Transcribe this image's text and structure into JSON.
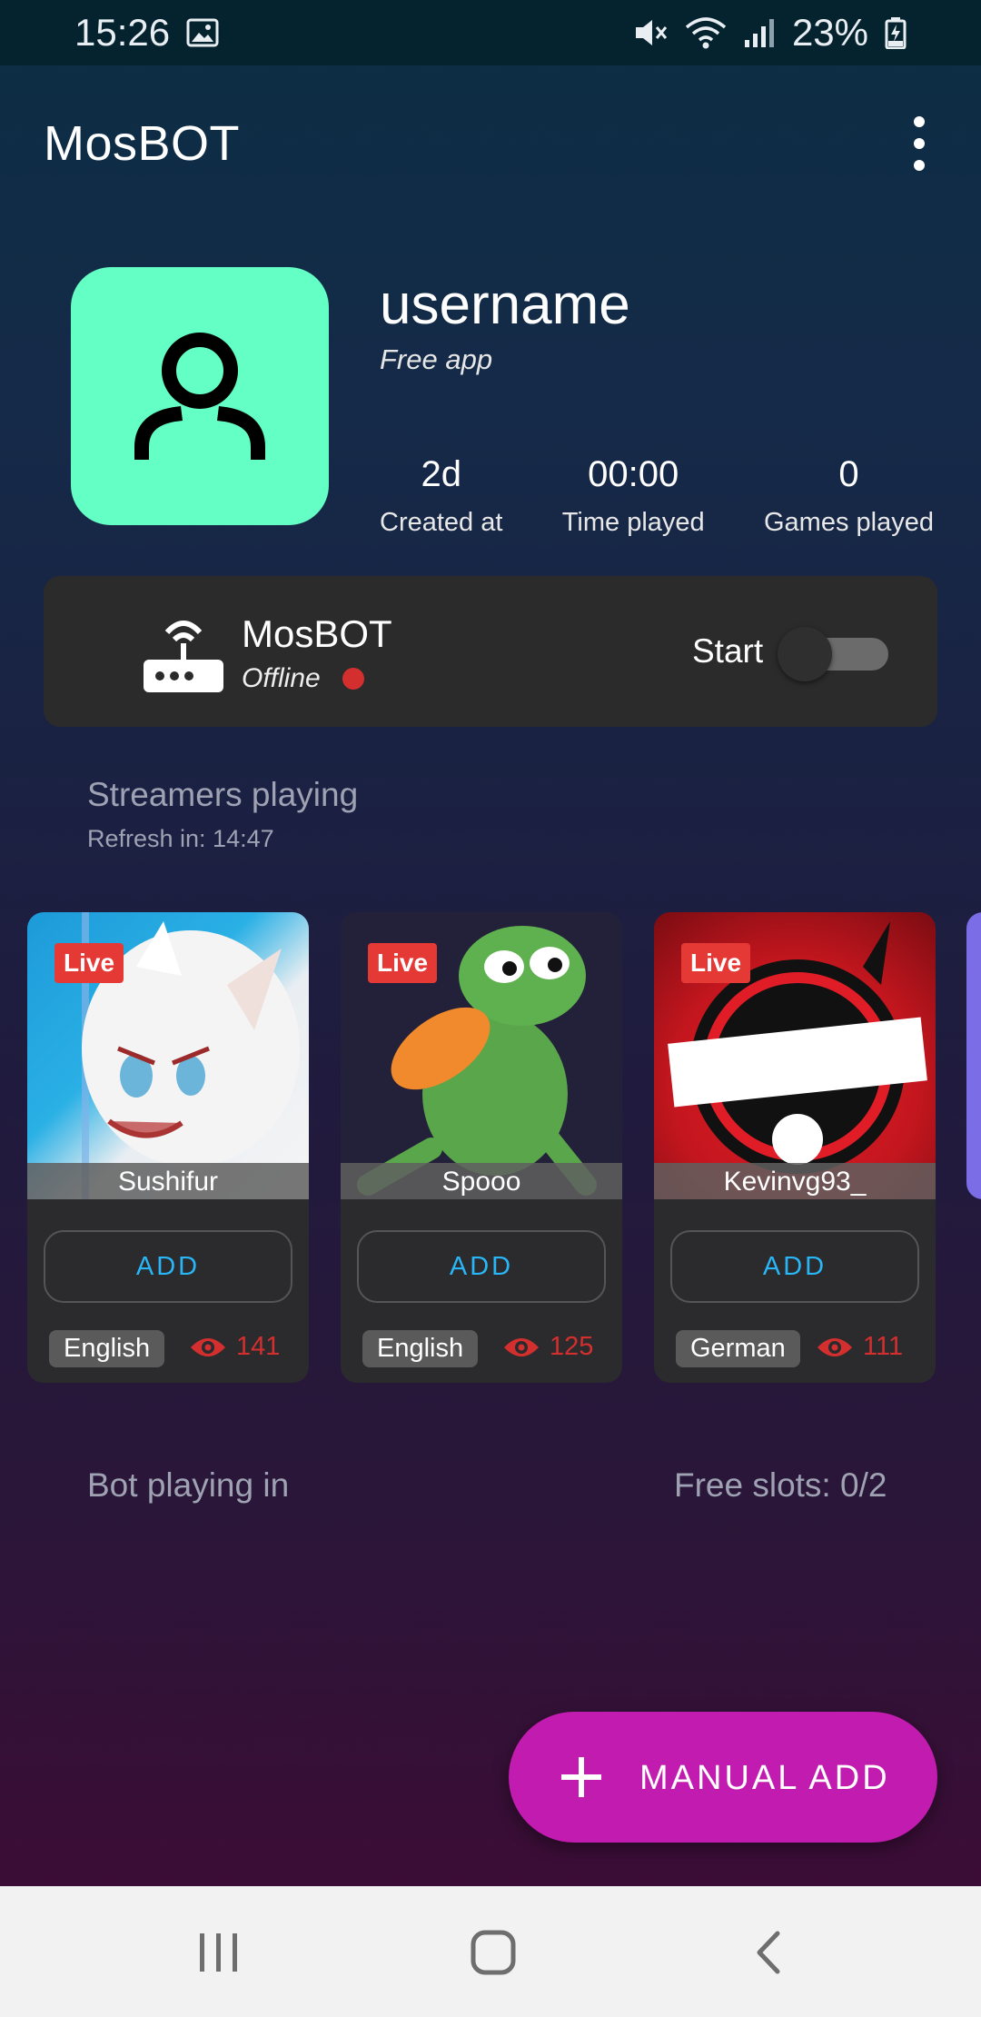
{
  "status_bar": {
    "time": "15:26",
    "battery": "23%",
    "icons": [
      "image-icon",
      "mute-icon",
      "wifi-icon",
      "signal-icon",
      "battery-charging-icon"
    ]
  },
  "app_bar": {
    "title": "MosBOT",
    "menu_icon": "more-vert-icon"
  },
  "profile": {
    "username": "username",
    "plan": "Free app",
    "avatar_icon": "person-icon",
    "avatar_color": "#64ffc4",
    "stats": [
      {
        "value": "2d",
        "label": "Created at"
      },
      {
        "value": "00:00",
        "label": "Time played"
      },
      {
        "value": "0",
        "label": "Games played"
      }
    ]
  },
  "bot": {
    "name": "MosBOT",
    "status": "Offline",
    "status_color": "#d32f2f",
    "toggle_label": "Start",
    "toggle_on": false,
    "icon": "router-icon"
  },
  "streamers_section": {
    "title": "Streamers playing",
    "refresh": "Refresh in: 14:47"
  },
  "streamers": [
    {
      "badge": "Live",
      "name": "Sushifur",
      "button": "ADD",
      "language": "English",
      "viewers": "141"
    },
    {
      "badge": "Live",
      "name": "Spooo",
      "button": "ADD",
      "language": "English",
      "viewers": "125"
    },
    {
      "badge": "Live",
      "name": "Kevinvg93_",
      "button": "ADD",
      "language": "German",
      "viewers": "111"
    }
  ],
  "playing_section": {
    "title": "Bot playing in",
    "slots": "Free slots: 0/2"
  },
  "fab": {
    "label": "MANUAL ADD",
    "icon": "plus-icon",
    "color": "#c21bb0"
  },
  "nav_bar": {
    "buttons": [
      "recent-apps-icon",
      "home-icon",
      "back-icon"
    ]
  },
  "colors": {
    "accent_blue": "#29b6f6",
    "live_red": "#e53935",
    "card_bg": "#2b2a2d"
  }
}
